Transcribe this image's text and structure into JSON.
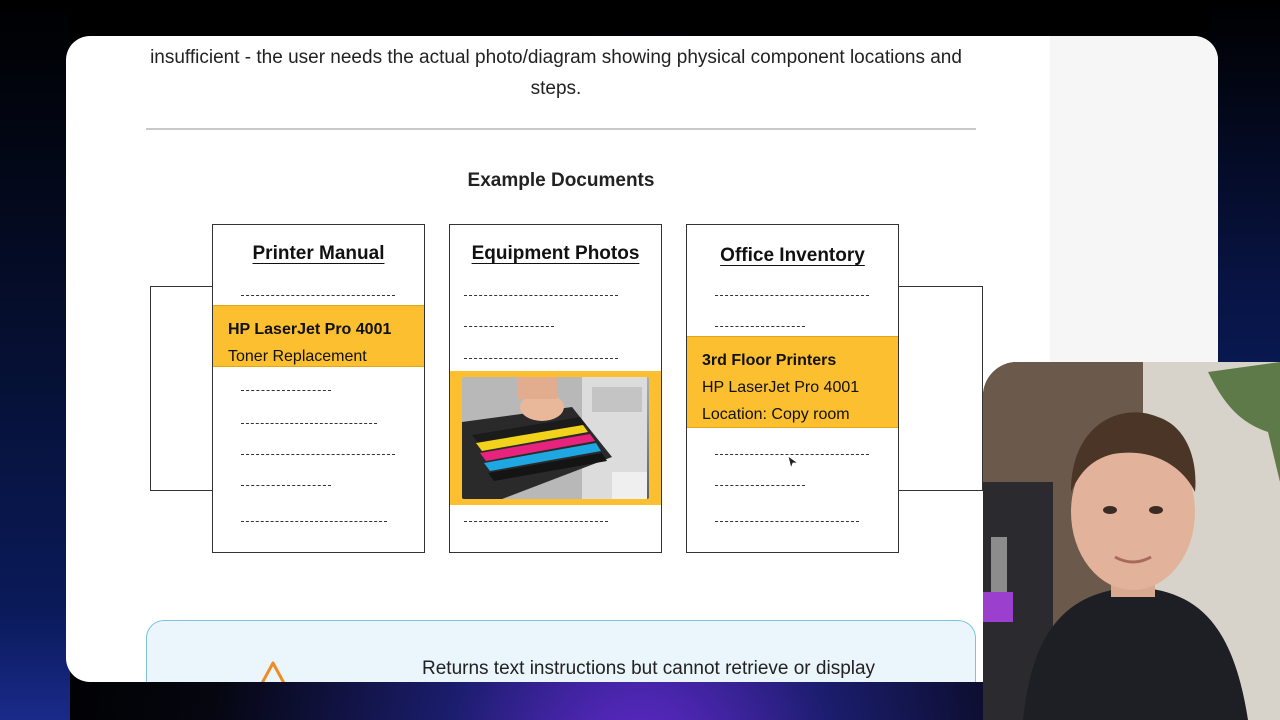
{
  "slide": {
    "intro_text": "insufficient - the user needs the actual photo/diagram showing physical component locations and steps.",
    "section_title": "Example Documents",
    "cards": [
      {
        "title": "Printer Manual",
        "highlight_title": "HP LaserJet Pro 4001",
        "highlight_subtitle": "Toner Replacement"
      },
      {
        "title": "Equipment Photos"
      },
      {
        "title": "Office Inventory",
        "highlight_title": "3rd Floor Printers",
        "highlight_line2": "HP LaserJet Pro 4001",
        "highlight_line3": "Location: Copy room"
      }
    ],
    "callout_text": "Returns text instructions but cannot retrieve or display"
  },
  "colors": {
    "highlight": "#fbbf30",
    "callout_bg": "#eaf6fb",
    "callout_border": "#7cc3dc",
    "warning": "#f08a24"
  },
  "icons": [
    "warning-icon",
    "mouse-cursor-icon"
  ]
}
